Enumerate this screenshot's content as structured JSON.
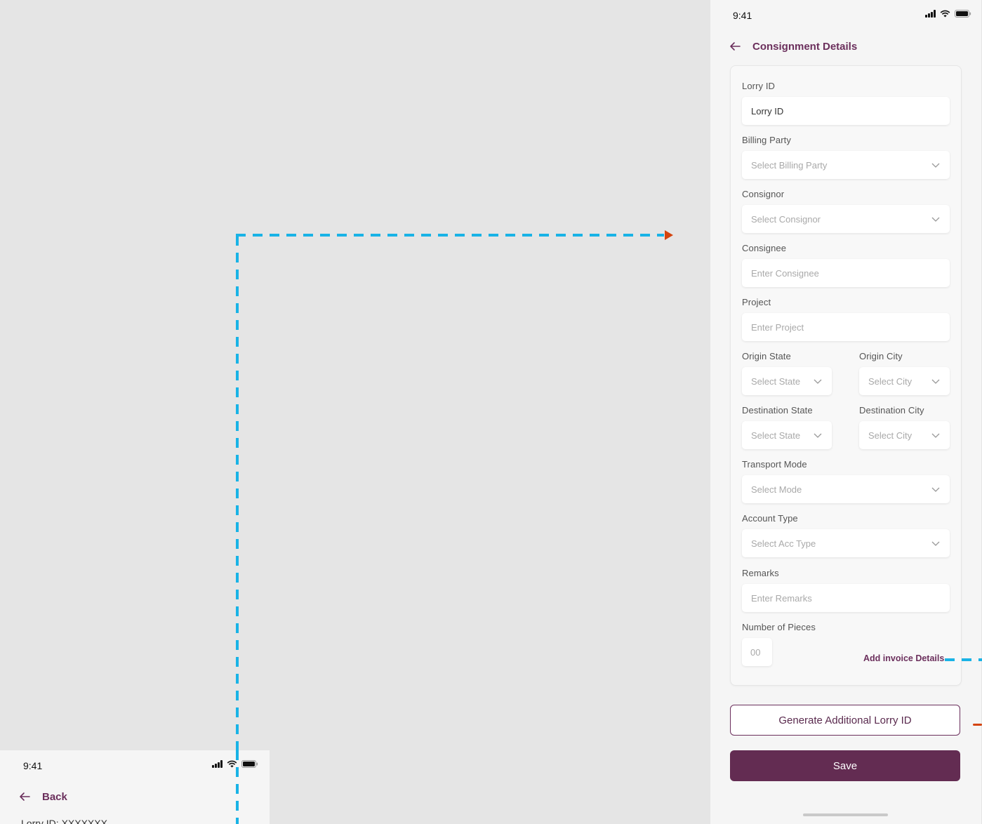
{
  "colors": {
    "accent": "#6b2f5c",
    "primary_button": "#632c52",
    "connector_line": "#19b3e6",
    "connector_arrow": "#d4440f",
    "background": "#e5e5e5"
  },
  "phone_main": {
    "status_bar": {
      "time": "9:41",
      "icons": [
        "signal-icon",
        "wifi-icon",
        "battery-icon"
      ]
    },
    "header": {
      "back_icon": "back-arrow-icon",
      "title": "Consignment Details"
    },
    "form": {
      "lorry_id": {
        "label": "Lorry ID",
        "value": "Lorry ID"
      },
      "billing_party": {
        "label": "Billing Party",
        "placeholder": "Select Billing Party"
      },
      "consignor": {
        "label": "Consignor",
        "placeholder": "Select Consignor"
      },
      "consignee": {
        "label": "Consignee",
        "placeholder": "Enter Consignee"
      },
      "project": {
        "label": "Project",
        "placeholder": "Enter Project"
      },
      "origin_state": {
        "label": "Origin State",
        "placeholder": "Select State"
      },
      "origin_city": {
        "label": "Origin City",
        "placeholder": "Select City"
      },
      "destination_state": {
        "label": "Destination State",
        "placeholder": "Select State"
      },
      "destination_city": {
        "label": "Destination City",
        "placeholder": "Select City"
      },
      "transport_mode": {
        "label": "Transport Mode",
        "placeholder": "Select Mode"
      },
      "account_type": {
        "label": "Account Type",
        "placeholder": "Select Acc Type"
      },
      "remarks": {
        "label": "Remarks",
        "placeholder": "Enter Remarks"
      },
      "pieces": {
        "label": "Number of Pieces",
        "placeholder": "00"
      },
      "add_invoice_link": "Add invoice Details"
    },
    "buttons": {
      "generate": "Generate Additional Lorry ID",
      "save": "Save"
    }
  },
  "phone_secondary": {
    "status_bar": {
      "time": "9:41"
    },
    "header": {
      "back_label": "Back"
    },
    "lorry_line": "Lorry ID: XXXXXXX"
  }
}
